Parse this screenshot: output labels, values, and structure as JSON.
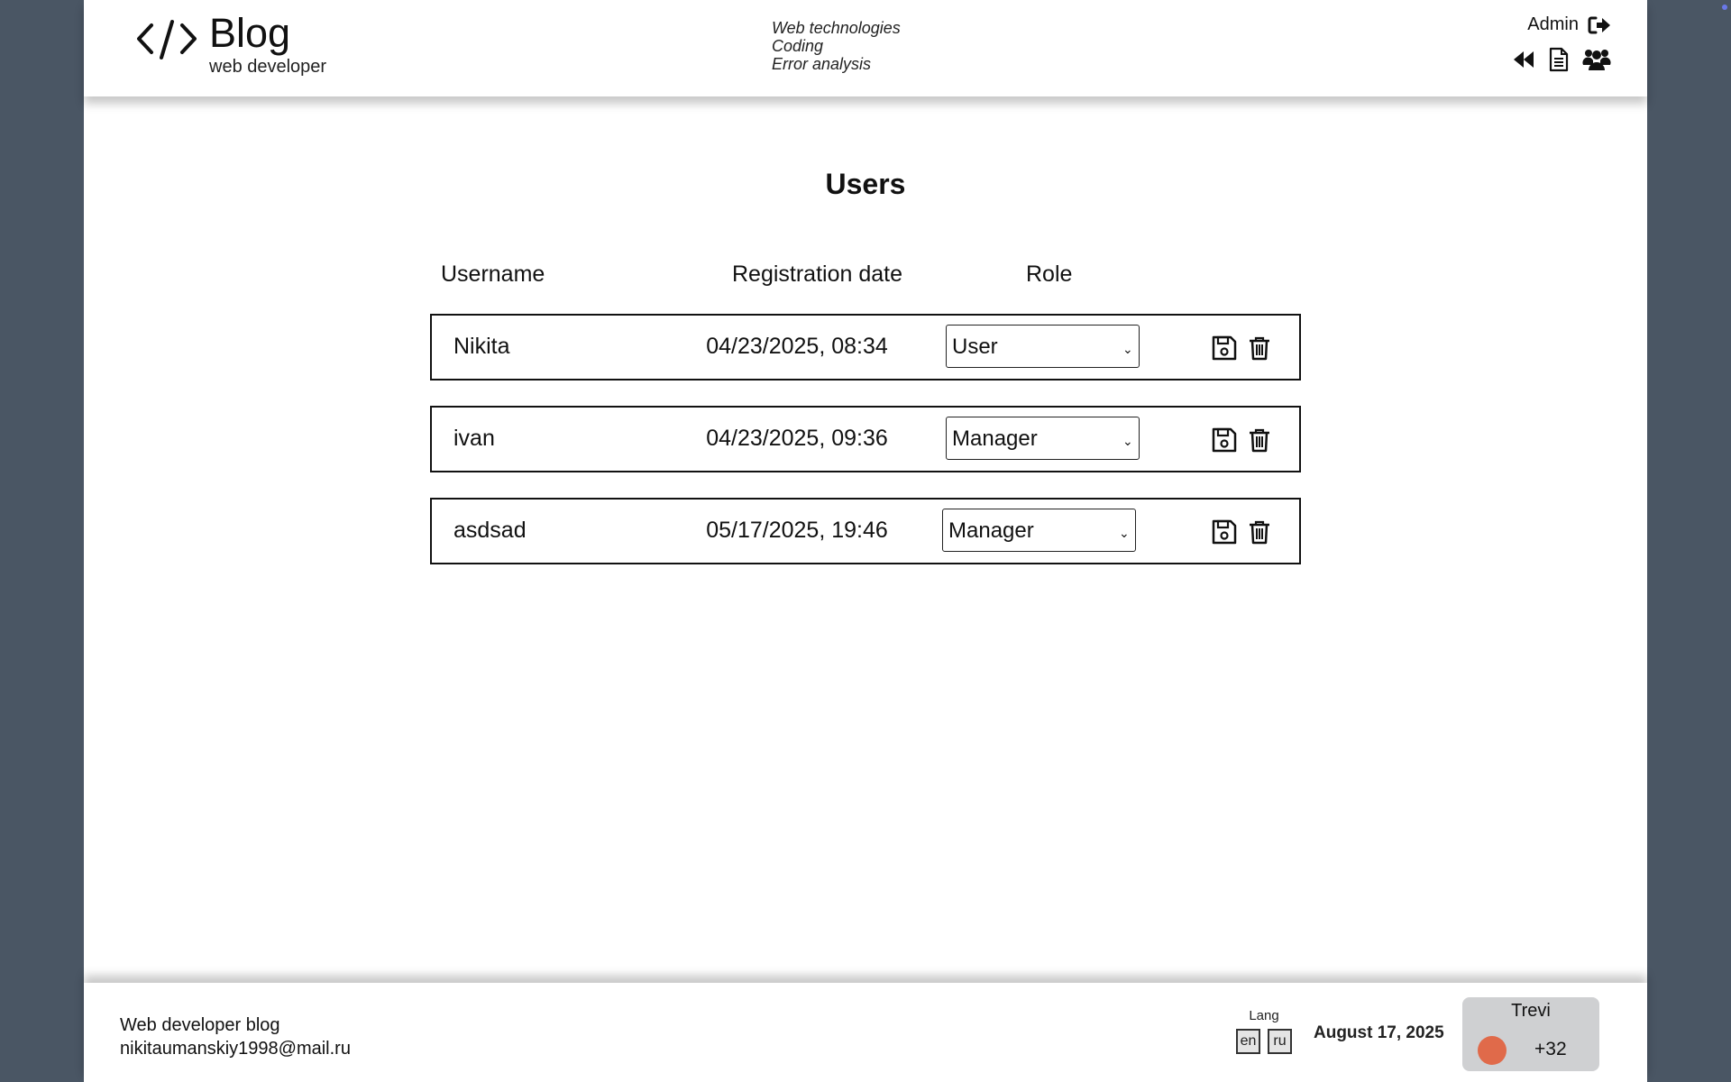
{
  "header": {
    "logo_title": "Blog",
    "logo_subtitle": "web developer",
    "topics": [
      "Web technologies",
      "Coding",
      "Error analysis"
    ],
    "admin_name": "Admin"
  },
  "main": {
    "title": "Users",
    "columns": [
      "Username",
      "Registration date",
      "Role"
    ],
    "rows": [
      {
        "username": "Nikita",
        "date": "04/23/2025, 08:34",
        "role": "User"
      },
      {
        "username": "ivan",
        "date": "04/23/2025, 09:36",
        "role": "Manager"
      },
      {
        "username": "asdsad",
        "date": "05/17/2025, 19:46",
        "role": "Manager"
      }
    ],
    "role_options": [
      "User",
      "Manager"
    ]
  },
  "footer": {
    "blog_name": "Web developer blog",
    "email": "nikitaumanskiy1998@mail.ru",
    "lang_label": "Lang",
    "lang_options": [
      "en",
      "ru"
    ],
    "date": "August 17, 2025",
    "weather": {
      "city": "Trevi",
      "temp": "+32",
      "dot_color": "#e06a4a"
    }
  },
  "colors": {
    "background": "#4a5664",
    "page": "#ffffff",
    "text": "#111111"
  },
  "icons": {
    "logo": "code-icon",
    "logout": "sign-out-icon",
    "back": "backward-icon",
    "posts": "document-icon",
    "users": "users-icon",
    "save": "floppy-disk-icon",
    "delete": "trash-icon"
  }
}
